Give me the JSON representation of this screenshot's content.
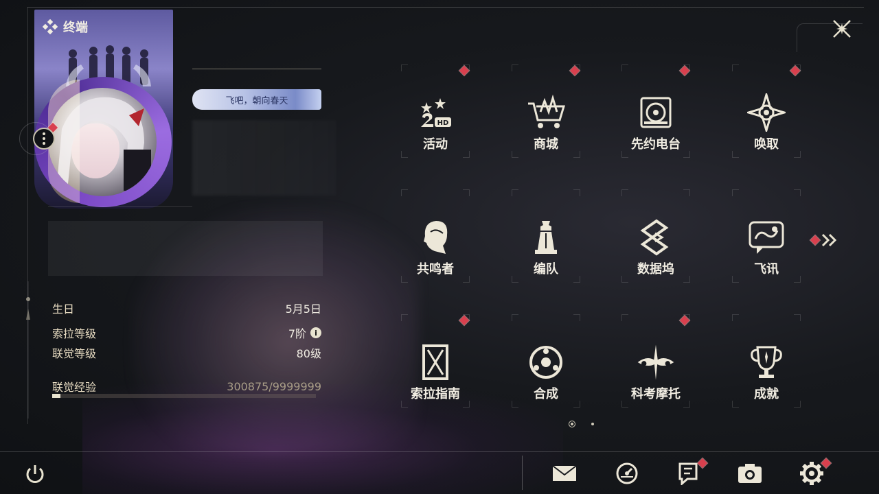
{
  "header": {
    "title": "终端"
  },
  "profile": {
    "title_badge": "飞吧，朝向春天",
    "birthday_label": "生日",
    "birthday_value": "5月5日",
    "sola_level_label": "索拉等级",
    "sola_level_value": "7阶",
    "union_level_label": "联觉等级",
    "union_level_value": "80级",
    "union_exp_label": "联觉经验",
    "union_exp_value": "300875/9999999",
    "union_exp_fraction": 0.03
  },
  "menu": {
    "items": [
      {
        "label": "活动",
        "icon": "event-icon",
        "badge": true
      },
      {
        "label": "商城",
        "icon": "shop-icon",
        "badge": true
      },
      {
        "label": "先约电台",
        "icon": "radio-icon",
        "badge": true
      },
      {
        "label": "唤取",
        "icon": "convene-icon",
        "badge": true
      },
      {
        "label": "共鸣者",
        "icon": "resonator-icon",
        "badge": false
      },
      {
        "label": "编队",
        "icon": "team-icon",
        "badge": false
      },
      {
        "label": "数据坞",
        "icon": "databank-icon",
        "badge": false
      },
      {
        "label": "飞讯",
        "icon": "message-icon",
        "badge": false
      },
      {
        "label": "索拉指南",
        "icon": "guidebook-icon",
        "badge": true
      },
      {
        "label": "合成",
        "icon": "synthesis-icon",
        "badge": false
      },
      {
        "label": "科考摩托",
        "icon": "motorbike-icon",
        "badge": true
      },
      {
        "label": "成就",
        "icon": "achievement-icon",
        "badge": false
      }
    ],
    "page_current": 1,
    "page_total": 2
  },
  "bottom_bar": {
    "buttons": [
      {
        "icon": "mail-icon",
        "badge": false
      },
      {
        "icon": "clock-icon",
        "badge": false
      },
      {
        "icon": "notice-icon",
        "badge": true
      },
      {
        "icon": "camera-icon",
        "badge": false
      },
      {
        "icon": "settings-gear-icon",
        "badge": true
      }
    ]
  },
  "colors": {
    "accent_red": "#d8404e",
    "text_cream": "#e8dcc2",
    "bg_dark": "#17191d"
  }
}
